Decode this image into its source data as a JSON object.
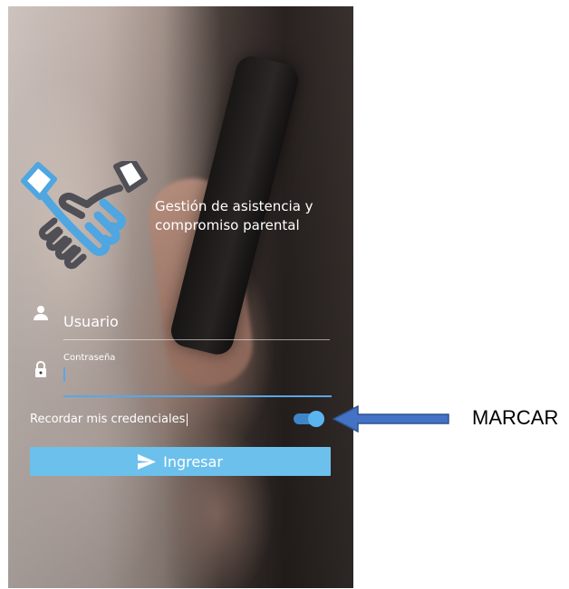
{
  "app": {
    "title": "Gestión de asistencia y compromiso parental",
    "logo_icon": "handshake-icon"
  },
  "login_form": {
    "username": {
      "placeholder": "Usuario",
      "icon": "user-icon"
    },
    "password": {
      "label": "Contraseña",
      "icon": "lock-icon"
    },
    "remember": {
      "label": "Recordar mis credenciales",
      "checked": true
    },
    "submit": {
      "label": "Ingresar",
      "icon": "send-icon"
    }
  },
  "annotation": {
    "label": "MARCAR"
  },
  "colors": {
    "accent": "#5aa6e6",
    "button": "#6cc0ec",
    "toggle_track": "#3f86c8",
    "arrow": "#4472c4"
  }
}
